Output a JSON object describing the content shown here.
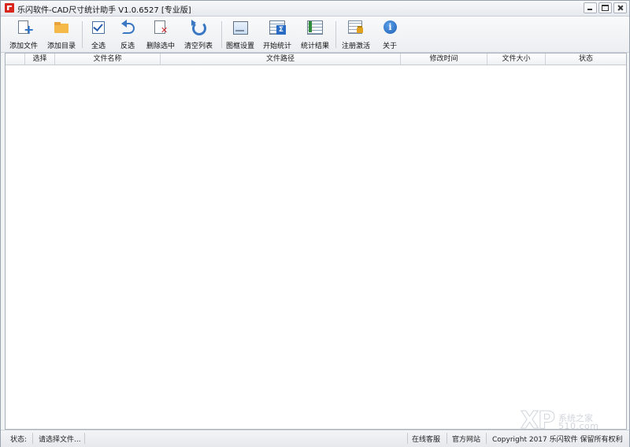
{
  "window": {
    "title": "乐闪软件-CAD尺寸统计助手 V1.0.6527 [专业版]"
  },
  "toolbar": {
    "buttons": [
      {
        "label": "添加文件",
        "icon": "add-file-icon"
      },
      {
        "label": "添加目录",
        "icon": "folder-icon"
      },
      {
        "label": "全选",
        "icon": "checkbox-icon"
      },
      {
        "label": "反选",
        "icon": "undo-icon"
      },
      {
        "label": "删除选中",
        "icon": "delete-file-icon"
      },
      {
        "label": "清空列表",
        "icon": "refresh-icon"
      },
      {
        "label": "图框设置",
        "icon": "frame-icon"
      },
      {
        "label": "开始统计",
        "icon": "sum-icon"
      },
      {
        "label": "统计结果",
        "icon": "result-icon"
      },
      {
        "label": "注册激活",
        "icon": "lock-icon"
      },
      {
        "label": "关于",
        "icon": "info-icon"
      }
    ]
  },
  "table": {
    "columns": [
      "选择",
      "文件名称",
      "文件路径",
      "修改时间",
      "文件大小",
      "状态"
    ],
    "rows": []
  },
  "statusbar": {
    "status_label": "状态:",
    "status_text": "请选择文件...",
    "online_service": "在线客服",
    "official_site": "官方网站",
    "copyright": "Copyright 2017 乐闪软件 保留所有权利"
  },
  "watermark": {
    "logo": "XP",
    "line1": "系统之家",
    "line2": "510.com"
  }
}
